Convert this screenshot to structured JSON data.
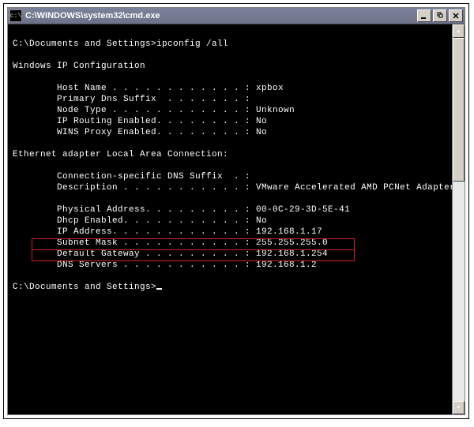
{
  "window": {
    "title": "C:\\WINDOWS\\system32\\cmd.exe"
  },
  "console": {
    "prompt1": "C:\\Documents and Settings>",
    "command1": "ipconfig /all",
    "blank": "",
    "header1": "Windows IP Configuration",
    "host_name": "        Host Name . . . . . . . . . . . . : xpbox",
    "primary_suffix": "        Primary Dns Suffix  . . . . . . . :",
    "node_type": "        Node Type . . . . . . . . . . . . : Unknown",
    "ip_routing": "        IP Routing Enabled. . . . . . . . : No",
    "wins_proxy": "        WINS Proxy Enabled. . . . . . . . : No",
    "adapter_header": "Ethernet adapter Local Area Connection:",
    "conn_suffix": "        Connection-specific DNS Suffix  . :",
    "description": "        Description . . . . . . . . . . . : VMware Accelerated AMD PCNet Adapter",
    "phys_addr": "        Physical Address. . . . . . . . . : 00-0C-29-3D-5E-41",
    "dhcp": "        Dhcp Enabled. . . . . . . . . . . : No",
    "ip_addr": "        IP Address. . . . . . . . . . . . : 192.168.1.17",
    "subnet": "        Subnet Mask . . . . . . . . . . . : 255.255.255.0",
    "gateway": "        Default Gateway . . . . . . . . . : 192.168.1.254",
    "dns": "        DNS Servers . . . . . . . . . . . : 192.168.1.2",
    "prompt2": "C:\\Documents and Settings>"
  }
}
